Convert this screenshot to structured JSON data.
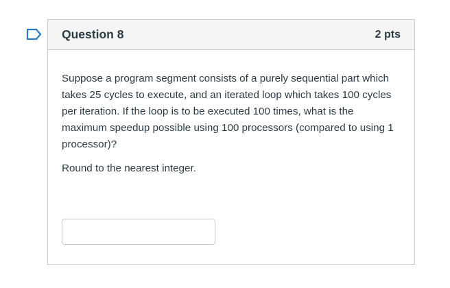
{
  "question": {
    "title": "Question 8",
    "points": "2 pts",
    "text": "Suppose a program segment consists of a purely sequential part which takes 25 cycles to execute, and an iterated loop which takes 100 cycles per iteration. If the loop is to be executed 100 times, what is the maximum speedup possible using 100 processors (compared to using 1 processor)?",
    "instruction": "Round to the nearest integer.",
    "answer_value": ""
  },
  "icons": {
    "flag": "flag-icon"
  },
  "colors": {
    "text": "#2d3b45",
    "flag": "#2b7abc",
    "border": "#c7cdd1",
    "header_bg": "#f5f5f5"
  }
}
